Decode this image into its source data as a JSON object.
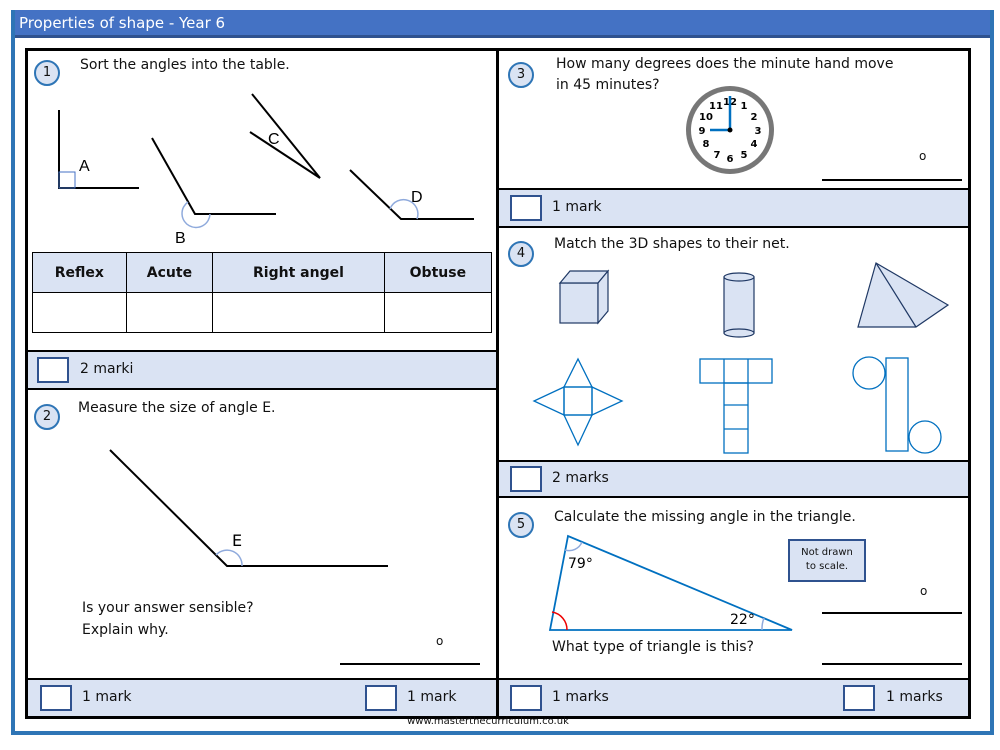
{
  "header": {
    "title": "Properties of shape - Year 6"
  },
  "q1": {
    "number": "1",
    "prompt": "Sort the angles into the table.",
    "labels": [
      "A",
      "B",
      "C",
      "D"
    ],
    "table_headers": [
      "Reflex",
      "Acute",
      "Right angel",
      "Obtuse"
    ],
    "marks": "2 marki"
  },
  "q2": {
    "number": "2",
    "prompt": "Measure the size of angle E.",
    "label": "E",
    "followup1": "Is your answer sensible?",
    "followup2": "Explain why.",
    "degree": "o",
    "marks_left": "1 mark",
    "marks_right": "1 mark"
  },
  "q3": {
    "number": "3",
    "prompt1": "How many degrees does the minute hand move",
    "prompt2": "in 45 minutes?",
    "degree": "o",
    "marks": "1 mark",
    "clock_numbers": [
      "12",
      "1",
      "2",
      "3",
      "4",
      "5",
      "6",
      "7",
      "8",
      "9",
      "10",
      "11"
    ]
  },
  "q4": {
    "number": "4",
    "prompt": "Match the 3D shapes to their net.",
    "marks": "2 marks"
  },
  "q5": {
    "number": "5",
    "prompt": "Calculate the missing angle in the triangle.",
    "angle1": "79°",
    "angle2": "22°",
    "note1": "Not drawn",
    "note2": "to scale.",
    "degree": "o",
    "question2": "What type of triangle is this?",
    "marks_left": "1 marks",
    "marks_right": "1 marks"
  },
  "footer": {
    "url": "www.masterthecurriculum.co.uk"
  },
  "colors": {
    "accent": "#4472c4",
    "frame": "#2e75b6",
    "bar": "#dae3f3",
    "shape": "#0070c0"
  }
}
